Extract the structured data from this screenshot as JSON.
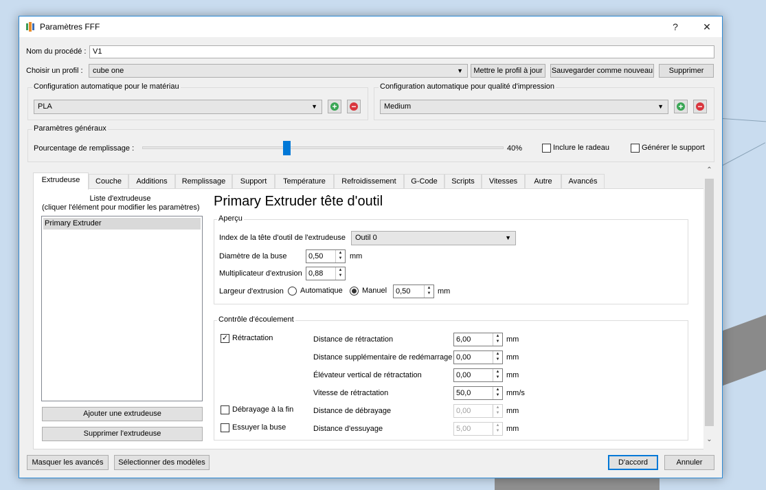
{
  "window": {
    "title": "Paramètres FFF",
    "help_label": "?",
    "close_label": "✕"
  },
  "process": {
    "name_label": "Nom du procédé :",
    "name_value": "V1",
    "profile_label": "Choisir un profil :",
    "profile_value": "cube one",
    "update_profile_label": "Mettre le profil à jour",
    "save_new_label": "Sauvegarder comme nouveau",
    "delete_label": "Supprimer"
  },
  "material": {
    "group_title": "Configuration automatique pour le matériau",
    "value": "PLA"
  },
  "quality": {
    "group_title": "Configuration automatique pour qualité d'impression",
    "value": "Medium"
  },
  "general": {
    "group_title": "Paramètres généraux",
    "infill_label": "Pourcentage de remplissage :",
    "infill_value_text": "40%",
    "infill_fraction": 0.4,
    "raft_label": "Inclure le radeau",
    "raft_checked": false,
    "support_label": "Générer le support",
    "support_checked": false
  },
  "tabs": [
    {
      "label": "Extrudeuse",
      "active": true
    },
    {
      "label": "Couche"
    },
    {
      "label": "Additions"
    },
    {
      "label": "Remplissage"
    },
    {
      "label": "Support"
    },
    {
      "label": "Température"
    },
    {
      "label": "Refroidissement"
    },
    {
      "label": "G-Code"
    },
    {
      "label": "Scripts"
    },
    {
      "label": "Vitesses"
    },
    {
      "label": "Autre"
    },
    {
      "label": "Avancés"
    }
  ],
  "extruder_list": {
    "heading_line1": "Liste d'extrudeuse",
    "heading_line2": "(cliquer l'élément pour modifier les paramètres)",
    "items": [
      "Primary Extruder"
    ],
    "add_label": "Ajouter une extrudeuse",
    "remove_label": "Supprimer l'extrudeuse"
  },
  "extruder": {
    "heading": "Primary Extruder tête d'outil",
    "overview_title": "Aperçu",
    "tool_index_label": "Index de la tête d'outil de l'extrudeuse",
    "tool_index_value": "Outil 0",
    "nozzle_label": "Diamètre de la buse",
    "nozzle_value": "0,50",
    "nozzle_unit": "mm",
    "multiplier_label": "Multiplicateur d'extrusion",
    "multiplier_value": "0,88",
    "width_label": "Largeur d'extrusion",
    "auto_label": "Automatique",
    "manual_label": "Manuel",
    "width_value": "0,50",
    "width_unit": "mm"
  },
  "flow": {
    "group_title": "Contrôle d'écoulement",
    "retraction_label": "Rétractation",
    "retraction_checked": true,
    "coast_label": "Débrayage à la fin",
    "coast_checked": false,
    "wipe_label": "Essuyer la buse",
    "wipe_checked": false,
    "rows": [
      {
        "label": "Distance de rétractation",
        "value": "6,00",
        "unit": "mm"
      },
      {
        "label": "Distance supplémentaire de redémarrage",
        "value": "0,00",
        "unit": "mm"
      },
      {
        "label": "Élévateur vertical de rétractation",
        "value": "0,00",
        "unit": "mm"
      },
      {
        "label": "Vitesse de rétractation",
        "value": "50,0",
        "unit": "mm/s"
      },
      {
        "label": "Distance de débrayage",
        "value": "0,00",
        "unit": "mm"
      },
      {
        "label": "Distance d'essuyage",
        "value": "5,00",
        "unit": "mm"
      }
    ]
  },
  "footer": {
    "hide_advanced_label": "Masquer les avancés",
    "select_models_label": "Sélectionner des modèles",
    "ok_label": "D'accord",
    "cancel_label": "Annuler"
  },
  "colors": {
    "accent": "#0078d7",
    "add_green": "#3aa655",
    "remove_red": "#d9363e"
  },
  "icons": {
    "add": "plus-circle",
    "remove": "minus-circle",
    "dropdown": "▼",
    "scroll_up": "⌃",
    "scroll_down": "⌄"
  }
}
